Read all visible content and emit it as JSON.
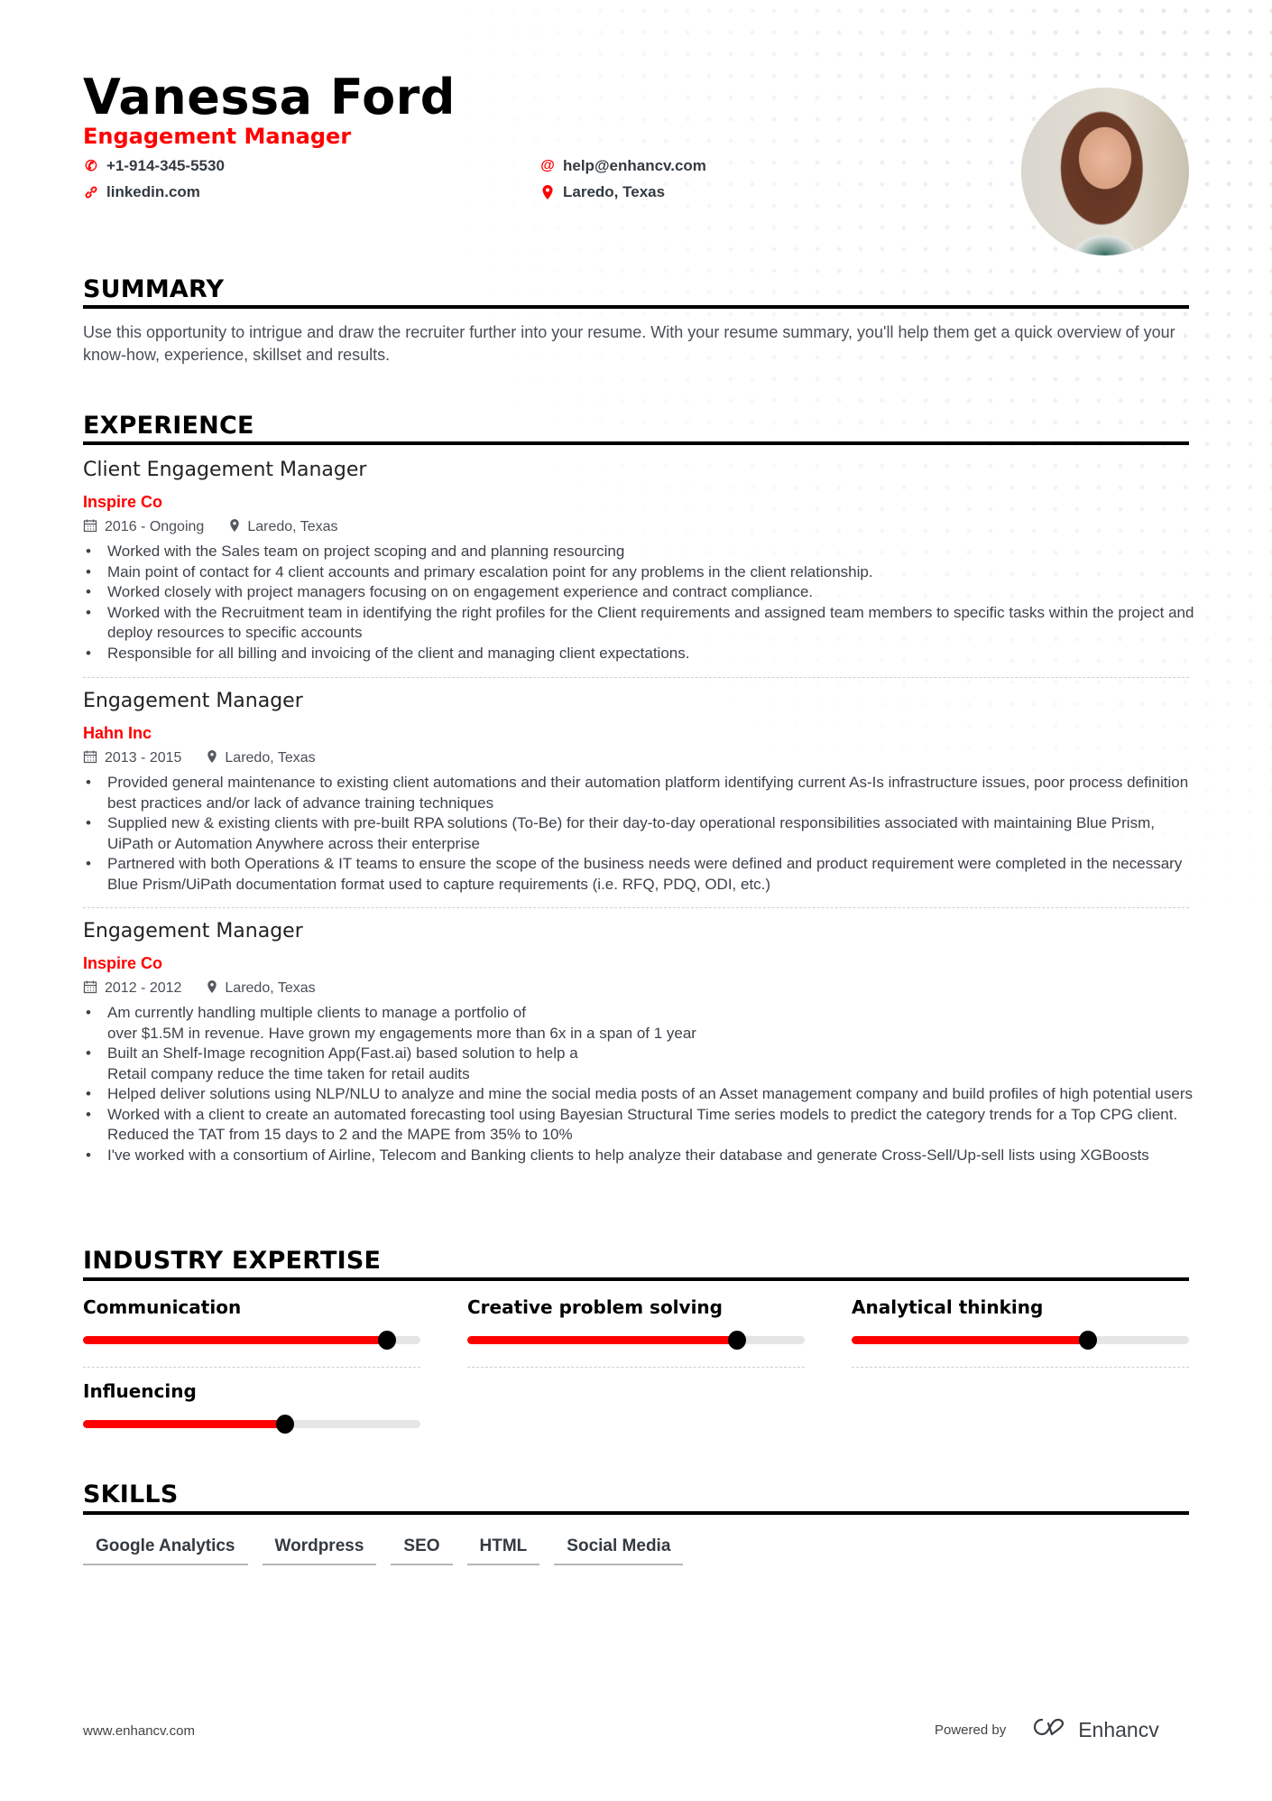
{
  "header": {
    "name": "Vanessa Ford",
    "title": "Engagement Manager",
    "contacts": [
      {
        "icon": "phone-icon",
        "glyph": "✆",
        "text": "+1-914-345-5530"
      },
      {
        "icon": "link-icon",
        "glyph": "🔗",
        "text": "linkedin.com"
      },
      {
        "icon": "at-icon",
        "glyph": "@",
        "text": "help@enhancv.com"
      },
      {
        "icon": "location-pin-icon",
        "glyph": "⚲",
        "text": "Laredo, Texas"
      }
    ],
    "photo_alt": "Profile photo"
  },
  "summary": {
    "heading": "SUMMARY",
    "text": "Use this opportunity to intrigue and draw the recruiter further into your resume. With your resume summary, you'll help them get a quick overview of your know-how, experience, skillset and results."
  },
  "experience": {
    "heading": "EXPERIENCE",
    "jobs": [
      {
        "title": "Client Engagement Manager",
        "company": "Inspire Co",
        "dates": "2016 - Ongoing",
        "location": "Laredo, Texas",
        "bullets": [
          "Worked with the Sales team on project scoping and and planning resourcing",
          "Main point of contact for 4 client accounts and primary escalation point for any problems in the client relationship.",
          "Worked closely with project managers focusing on on engagement experience and contract compliance.",
          "Worked with the Recruitment team in identifying the right profiles for the Client requirements and assigned team members to specific tasks within the project and deploy resources to specific accounts",
          "Responsible for all billing and invoicing of the client and managing client expectations."
        ]
      },
      {
        "title": "Engagement Manager",
        "company": "Hahn Inc",
        "dates": "2013 - 2015",
        "location": "Laredo, Texas",
        "bullets": [
          "Provided general maintenance to existing client automations and their automation platform identifying current As-Is infrastructure issues, poor process definition best practices and/or lack of advance training techniques",
          "Supplied new & existing clients with pre-built RPA solutions (To-Be) for their day-to-day operational responsibilities associated with maintaining Blue Prism, UiPath or Automation Anywhere across their enterprise",
          "Partnered with both Operations & IT teams to ensure the scope of the business needs were defined and product requirement were completed in the necessary Blue Prism/UiPath documentation format used to capture requirements (i.e. RFQ, PDQ, ODI, etc.)"
        ]
      },
      {
        "title": "Engagement Manager",
        "company": "Inspire Co",
        "dates": "2012 - 2012",
        "location": "Laredo, Texas",
        "bullets": [
          "Am currently handling multiple clients to manage a portfolio of\nover $1.5M in revenue. Have grown my engagements more than 6x in a span of 1 year",
          "Built an Shelf-Image recognition App(Fast.ai) based solution to help a\nRetail company reduce the time taken for retail audits",
          "Helped deliver solutions using NLP/NLU to analyze and mine the social media posts of an Asset management company and build profiles of high potential users",
          "Worked with a client to create an automated forecasting tool using Bayesian Structural Time series models to predict the category trends for a Top CPG client. Reduced the TAT from 15 days to 2 and the MAPE from 35% to 10%",
          "I've worked with a consortium of Airline, Telecom and Banking clients to help analyze their database and generate Cross-Sell/Up-sell lists using XGBoosts"
        ]
      }
    ]
  },
  "expertise": {
    "heading": "INDUSTRY EXPERTISE",
    "items": [
      {
        "label": "Communication",
        "level": 0.9
      },
      {
        "label": "Creative problem solving",
        "level": 0.8
      },
      {
        "label": "Analytical thinking",
        "level": 0.7
      },
      {
        "label": "Influencing",
        "level": 0.6
      }
    ]
  },
  "skills": {
    "heading": "SKILLS",
    "items": [
      "Google Analytics",
      "Wordpress",
      "SEO",
      "HTML",
      "Social Media"
    ]
  },
  "footer": {
    "website": "www.enhancv.com",
    "powered_by": "Powered by",
    "brand": "Enhancv"
  },
  "colors": {
    "accent": "#ff0000",
    "text": "#333a40",
    "heading": "#000000"
  }
}
